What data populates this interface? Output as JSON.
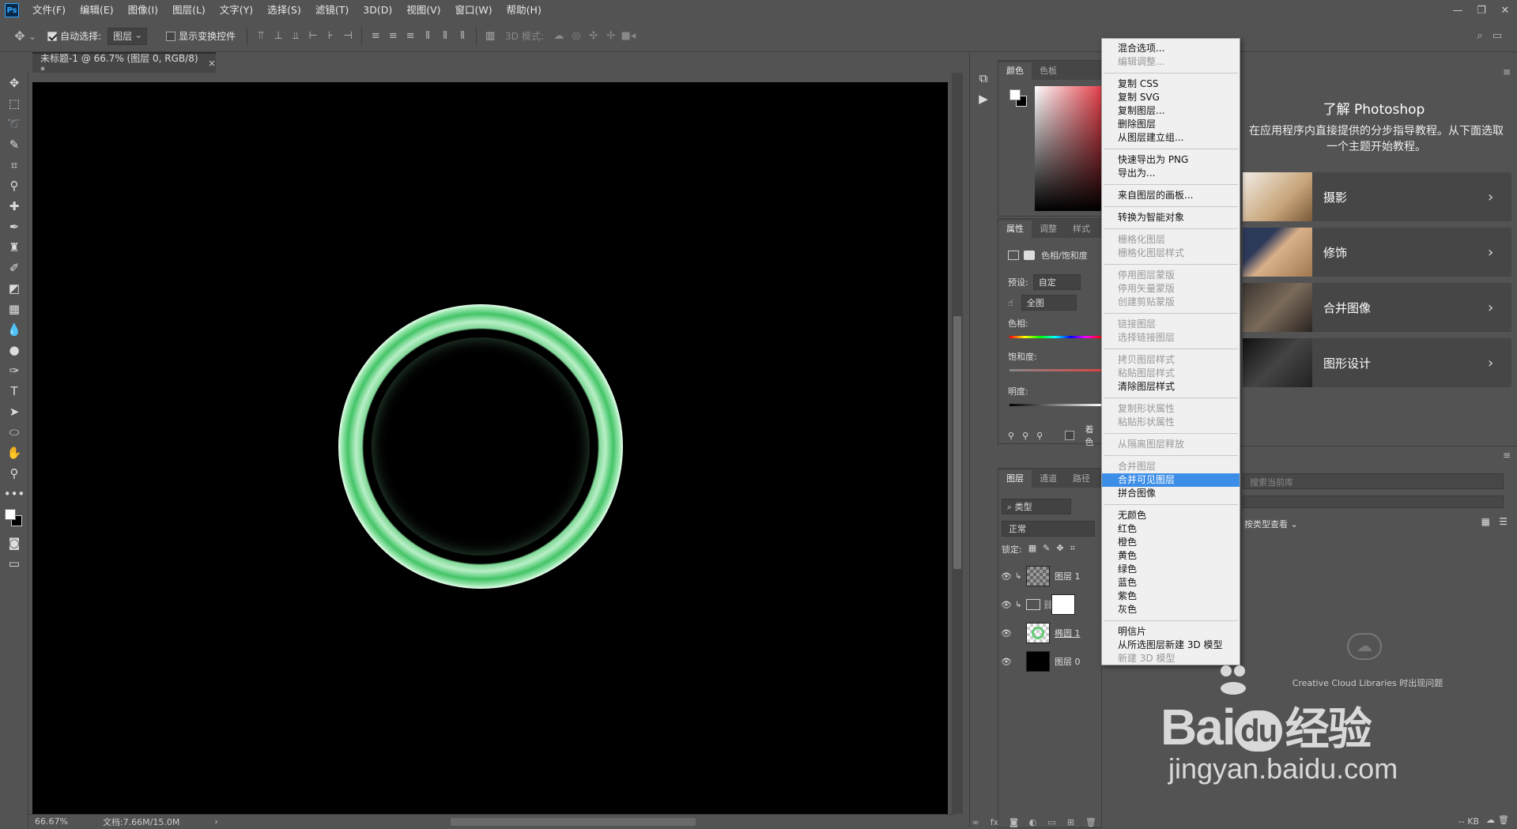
{
  "menubar": {
    "logo": "Ps",
    "items": [
      "文件(F)",
      "编辑(E)",
      "图像(I)",
      "图层(L)",
      "文字(Y)",
      "选择(S)",
      "滤镜(T)",
      "3D(D)",
      "视图(V)",
      "窗口(W)",
      "帮助(H)"
    ],
    "win_min": "—",
    "win_restore": "❐",
    "win_close": "✕"
  },
  "options": {
    "auto_select_label": "自动选择:",
    "auto_select_value": "图层",
    "transform_label": "显示变换控件",
    "mode_3d_label": "3D 模式:"
  },
  "document": {
    "tab_title": "未标题-1 @ 66.7% (图层 0, RGB/8) *",
    "close": "×"
  },
  "status": {
    "zoom": "66.67%",
    "doc_info": "文档:7.66M/15.0M",
    "arrow": "›"
  },
  "color_panel": {
    "tabs": [
      "颜色",
      "色板"
    ],
    "fg_color": "#ffffff",
    "bg_color": "#000000"
  },
  "properties_panel": {
    "tabs": [
      "属性",
      "调整",
      "样式"
    ],
    "type_label": "色相/饱和度",
    "preset_label": "预设:",
    "preset_value": "自定",
    "channel_value": "全图",
    "hue_label": "色相:",
    "saturation_label": "饱和度:",
    "lightness_label": "明度:",
    "colorize_label": "着色"
  },
  "layers_panel": {
    "tabs": [
      "图层",
      "通道",
      "路径"
    ],
    "filter_value": "类型",
    "blend_value": "正常",
    "lock_label": "锁定:",
    "layers": [
      {
        "name": "图层 1",
        "thumb": "#888888"
      },
      {
        "name": "",
        "thumb": "#ffffff"
      },
      {
        "name": "椭圆 1",
        "thumb": "#66bb77"
      },
      {
        "name": "图层 0",
        "thumb": "#000000"
      }
    ]
  },
  "context_menu": {
    "groups": [
      [
        {
          "label": "混合选项...",
          "enabled": true
        },
        {
          "label": "编辑调整...",
          "enabled": false
        }
      ],
      [
        {
          "label": "复制 CSS",
          "enabled": true
        },
        {
          "label": "复制 SVG",
          "enabled": true
        },
        {
          "label": "复制图层...",
          "enabled": true
        },
        {
          "label": "删除图层",
          "enabled": true
        },
        {
          "label": "从图层建立组...",
          "enabled": true
        }
      ],
      [
        {
          "label": "快速导出为 PNG",
          "enabled": true
        },
        {
          "label": "导出为...",
          "enabled": true
        }
      ],
      [
        {
          "label": "来自图层的画板...",
          "enabled": true
        }
      ],
      [
        {
          "label": "转换为智能对象",
          "enabled": true
        }
      ],
      [
        {
          "label": "栅格化图层",
          "enabled": false
        },
        {
          "label": "栅格化图层样式",
          "enabled": false
        }
      ],
      [
        {
          "label": "停用图层蒙版",
          "enabled": false
        },
        {
          "label": "停用矢量蒙版",
          "enabled": false
        },
        {
          "label": "创建剪贴蒙版",
          "enabled": false
        }
      ],
      [
        {
          "label": "链接图层",
          "enabled": false
        },
        {
          "label": "选择链接图层",
          "enabled": false
        }
      ],
      [
        {
          "label": "拷贝图层样式",
          "enabled": false
        },
        {
          "label": "粘贴图层样式",
          "enabled": false
        },
        {
          "label": "清除图层样式",
          "enabled": true
        }
      ],
      [
        {
          "label": "复制形状属性",
          "enabled": false
        },
        {
          "label": "粘贴形状属性",
          "enabled": false
        }
      ],
      [
        {
          "label": "从隔离图层释放",
          "enabled": false
        }
      ],
      [
        {
          "label": "合并图层",
          "enabled": false
        },
        {
          "label": "合并可见图层",
          "enabled": true,
          "highlighted": true
        },
        {
          "label": "拼合图像",
          "enabled": true
        }
      ],
      [
        {
          "label": "无颜色",
          "enabled": true
        },
        {
          "label": "红色",
          "enabled": true
        },
        {
          "label": "橙色",
          "enabled": true
        },
        {
          "label": "黄色",
          "enabled": true
        },
        {
          "label": "绿色",
          "enabled": true
        },
        {
          "label": "蓝色",
          "enabled": true
        },
        {
          "label": "紫色",
          "enabled": true
        },
        {
          "label": "灰色",
          "enabled": true
        }
      ],
      [
        {
          "label": "明信片",
          "enabled": true
        },
        {
          "label": "从所选图层新建 3D 模型",
          "enabled": true
        },
        {
          "label": "新建 3D 模型",
          "enabled": false
        }
      ]
    ]
  },
  "learn_panel": {
    "title": "了解 Photoshop",
    "description": "在应用程序内直接提供的分步指导教程。从下面选取一个主题开始教程。",
    "cards": [
      {
        "title": "摄影",
        "thumb": "#b89a7a"
      },
      {
        "title": "修饰",
        "thumb": "#a07850"
      },
      {
        "title": "合并图像",
        "thumb": "#5a5048"
      },
      {
        "title": "图形设计",
        "thumb": "#2a2a2a"
      }
    ]
  },
  "libraries_panel": {
    "search_placeholder": "搜索当前库",
    "view_label": "按类型查看",
    "message": "Creative Cloud Libraries 时出现问题",
    "size": "-- KB"
  },
  "watermark": {
    "brand": "Bai",
    "brand2": "du",
    "cn": "经验",
    "url": "jingyan.baidu.com"
  }
}
